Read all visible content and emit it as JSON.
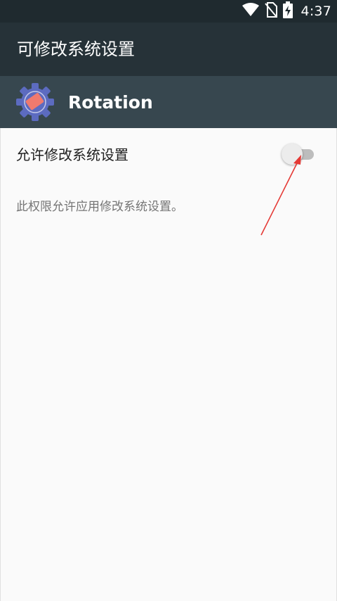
{
  "status_bar": {
    "time": "4:37",
    "icons": [
      "wifi-icon",
      "no-sim-icon",
      "battery-charging-icon"
    ]
  },
  "app_bar": {
    "title": "可修改系统设置"
  },
  "app_header": {
    "name": "Rotation",
    "icon": "rotation-app-icon"
  },
  "setting": {
    "label": "允许修改系统设置",
    "description": "此权限允许应用修改系统设置。",
    "toggle_on": false
  },
  "annotation": {
    "arrow_color": "#e53935"
  },
  "colors": {
    "status_bar": "#1f2a2f",
    "app_bar": "#263238",
    "app_header": "#37474f",
    "background": "#fafafa"
  }
}
